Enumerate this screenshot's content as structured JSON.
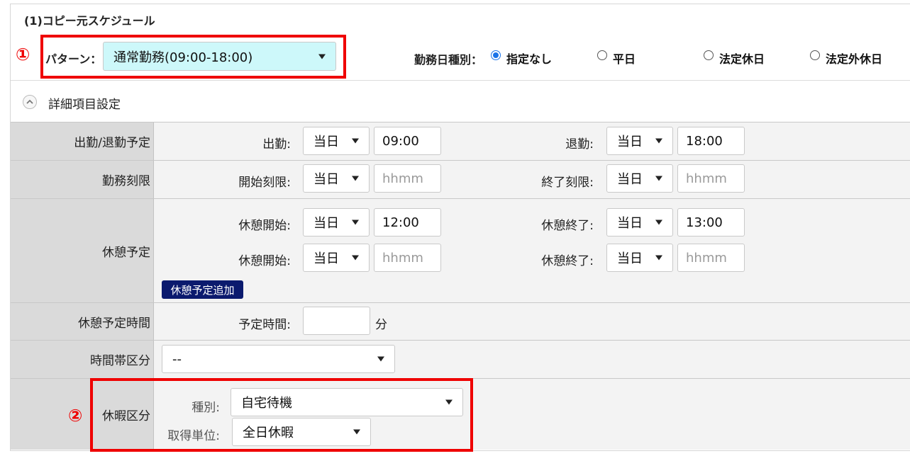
{
  "section": {
    "title": "(1)コピー元スケジュール",
    "pattern_label": "パターン：",
    "pattern_value": "通常勤務(09:00-18:00)",
    "daytype_label": "勤務日種別：",
    "daytype_options": [
      "指定なし",
      "平日",
      "法定休日",
      "法定外休日"
    ],
    "daytype_selected": "指定なし",
    "detail_toggle": "詳細項目設定"
  },
  "markers": {
    "one": "①",
    "two": "②"
  },
  "rows": {
    "attendance": {
      "header": "出勤/退勤予定",
      "in_label": "出勤:",
      "in_day": "当日",
      "in_time": "09:00",
      "out_label": "退勤:",
      "out_day": "当日",
      "out_time": "18:00"
    },
    "limit": {
      "header": "勤務刻限",
      "start_label": "開始刻限:",
      "start_day": "当日",
      "start_placeholder": "hhmm",
      "end_label": "終了刻限:",
      "end_day": "当日",
      "end_placeholder": "hhmm"
    },
    "break": {
      "header": "休憩予定",
      "start1_label": "休憩開始:",
      "start1_day": "当日",
      "start1_time": "12:00",
      "end1_label": "休憩終了:",
      "end1_day": "当日",
      "end1_time": "13:00",
      "start2_label": "休憩開始:",
      "start2_day": "当日",
      "start2_placeholder": "hhmm",
      "end2_label": "休憩終了:",
      "end2_day": "当日",
      "end2_placeholder": "hhmm",
      "add_button": "休憩予定追加"
    },
    "break_time": {
      "header": "休憩予定時間",
      "label": "予定時間:",
      "value": "",
      "unit": "分"
    },
    "timezone": {
      "header": "時間帯区分",
      "value": "--"
    },
    "leave": {
      "header": "休暇区分",
      "type_label": "種別:",
      "type_value": "自宅待機",
      "unit_label": "取得単位:",
      "unit_value": "全日休暇"
    }
  },
  "colors": {
    "accent": "#1a73e8",
    "highlight": "#ef0000",
    "pattern_bg": "#cdf8fa",
    "button_bg": "#0b1a6e"
  }
}
